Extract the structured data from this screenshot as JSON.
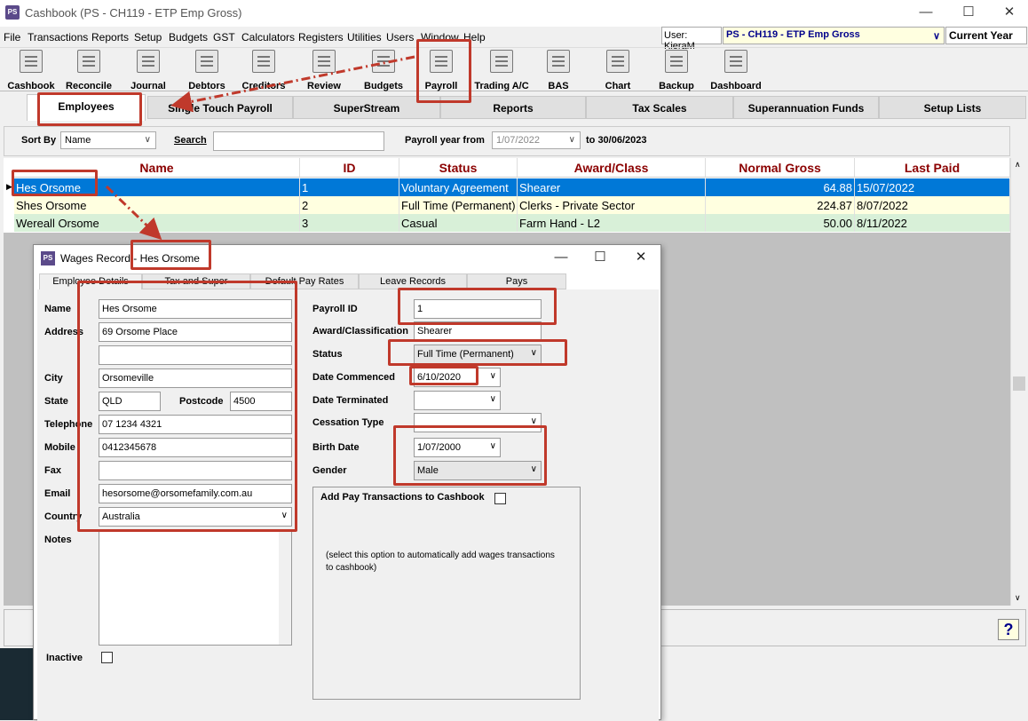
{
  "window": {
    "title": "Cashbook (PS - CH119 - ETP Emp Gross)",
    "app_icon": "PS"
  },
  "menu": [
    "File",
    "Transactions",
    "Reports",
    "Setup",
    "Budgets",
    "GST",
    "Calculators",
    "Registers",
    "Utilities",
    "Users",
    "Window",
    "Help"
  ],
  "status": {
    "user": "User: KieraM",
    "company": "PS - CH119 - ETP Emp Gross",
    "year": "Current Year"
  },
  "toolbar": [
    "Cashbook",
    "Reconcile",
    "Journal",
    "Debtors",
    "Creditors",
    "Review",
    "Budgets",
    "Payroll",
    "Trading A/C",
    "BAS",
    "Chart",
    "Backup",
    "Dashboard"
  ],
  "tabs": [
    "Employees",
    "Single Touch Payroll",
    "SuperStream",
    "Reports",
    "Tax Scales",
    "Superannuation Funds",
    "Setup Lists"
  ],
  "filter": {
    "sort_by_label": "Sort By",
    "sort_by_value": "Name",
    "search_label": "Search",
    "payroll_year_label": "Payroll year from",
    "from": "1/07/2022",
    "to_label": "to 30/06/2023"
  },
  "grid": {
    "columns": [
      "Name",
      "ID",
      "Status",
      "Award/Class",
      "Normal Gross",
      "Last Paid"
    ],
    "rows": [
      {
        "name": "Hes Orsome",
        "id": "1",
        "status": "Voluntary Agreement",
        "award": "Shearer",
        "gross": "64.88",
        "last_paid": "15/07/2022"
      },
      {
        "name": "Shes Orsome",
        "id": "2",
        "status": "Full Time (Permanent)",
        "award": "Clerks - Private Sector",
        "gross": "224.87",
        "last_paid": "8/07/2022"
      },
      {
        "name": "Wereall Orsome",
        "id": "3",
        "status": "Casual",
        "award": "Farm Hand - L2",
        "gross": "50.00",
        "last_paid": "8/11/2022"
      }
    ]
  },
  "help": "?",
  "dialog": {
    "title": "Wages Record - Hes Orsome",
    "icon": "PS",
    "tabs": [
      "Employee Details",
      "Tax and Super",
      "Default Pay Rates",
      "Leave Records",
      "Pays"
    ],
    "labels": {
      "name": "Name",
      "address": "Address",
      "city": "City",
      "state": "State",
      "postcode": "Postcode",
      "telephone": "Telephone",
      "mobile": "Mobile",
      "fax": "Fax",
      "email": "Email",
      "country": "Country",
      "notes": "Notes",
      "inactive": "Inactive",
      "payroll_id": "Payroll ID",
      "award": "Award/Classification",
      "status": "Status",
      "date_commenced": "Date Commenced",
      "date_terminated": "Date Terminated",
      "cessation_type": "Cessation Type",
      "birth_date": "Birth Date",
      "gender": "Gender"
    },
    "values": {
      "name": "Hes Orsome",
      "address1": "69 Orsome Place",
      "address2": "",
      "city": "Orsomeville",
      "state": "QLD",
      "postcode": "4500",
      "telephone": "07 1234 4321",
      "mobile": "0412345678",
      "fax": "",
      "email": "hesorsome@orsomefamily.com.au",
      "country": "Australia",
      "payroll_id": "1",
      "award": "Shearer",
      "status": "Full Time (Permanent)",
      "date_commenced": "6/10/2020",
      "date_terminated": "",
      "cessation_type": "",
      "birth_date": "1/07/2000",
      "gender": "Male"
    },
    "cashbook": {
      "label": "Add Pay Transactions to Cashbook",
      "note": "(select this option to automatically add wages transactions to cashbook)"
    }
  }
}
